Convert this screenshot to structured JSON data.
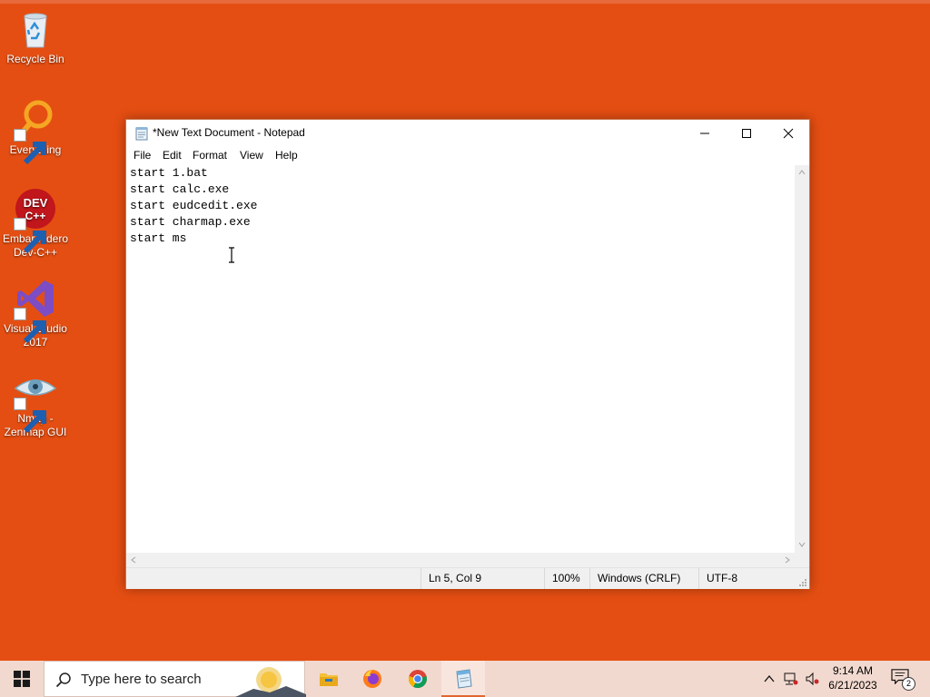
{
  "desktop": {
    "background_color": "#e54e12",
    "icons": [
      {
        "label": "Recycle Bin",
        "icon": "recycle-bin-icon"
      },
      {
        "label": "Everything",
        "icon": "everything-search-icon"
      },
      {
        "label": "Embarcadero Dev-C++",
        "icon": "devcpp-icon"
      },
      {
        "label": "Visual Studio 2017",
        "icon": "visual-studio-icon"
      },
      {
        "label": "Nmap - Zenmap GUI",
        "icon": "nmap-eye-icon"
      }
    ]
  },
  "notepad": {
    "title": "*New Text Document - Notepad",
    "menu": [
      "File",
      "Edit",
      "Format",
      "View",
      "Help"
    ],
    "lines": [
      "start 1.bat",
      "start calc.exe",
      "start eudcedit.exe",
      "start charmap.exe",
      "start ms"
    ],
    "status": {
      "position": "Ln 5, Col 9",
      "zoom": "100%",
      "line_ending": "Windows (CRLF)",
      "encoding": "UTF-8"
    }
  },
  "taskbar": {
    "search_placeholder": "Type here to search",
    "apps": [
      "file-explorer-icon",
      "firefox-icon",
      "chrome-icon",
      "notepad-icon"
    ],
    "active_app": "notepad-icon",
    "clock_time": "9:14 AM",
    "clock_date": "6/21/2023",
    "notification_count": "2"
  }
}
